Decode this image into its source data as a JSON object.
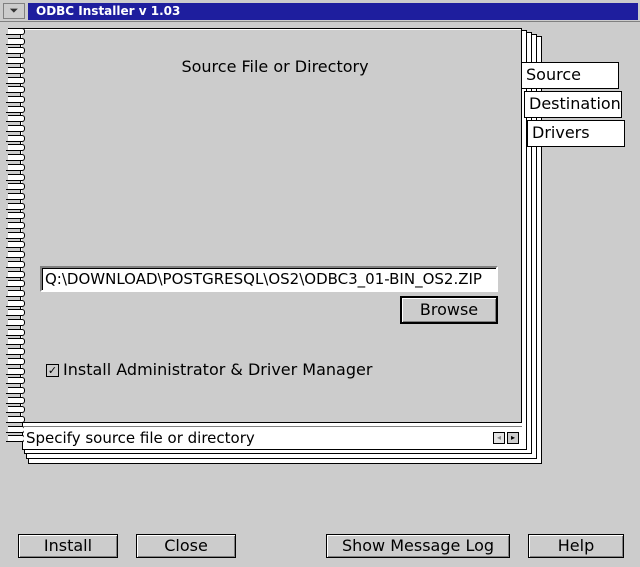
{
  "window": {
    "title": "ODBC Installer  v 1.03",
    "system_menu_icon": "system-menu-icon"
  },
  "notebook": {
    "page_title": "Source File or Directory",
    "tabs": [
      {
        "label": "Source"
      },
      {
        "label": "Destination"
      },
      {
        "label": "Drivers"
      }
    ],
    "source_path": "Q:\\DOWNLOAD\\POSTGRESQL\\OS2\\ODBC3_01-BIN_OS2.ZIP",
    "browse_label": "Browse",
    "checkbox_label": "Install Administrator & Driver Manager",
    "checkbox_checked": true,
    "status_text": "Specify source file or directory"
  },
  "buttons": {
    "install": "Install",
    "close": "Close",
    "show_message_log": "Show Message Log",
    "help": "Help"
  },
  "colors": {
    "title_bar": "#1e1e9e",
    "background": "#cccccc"
  }
}
